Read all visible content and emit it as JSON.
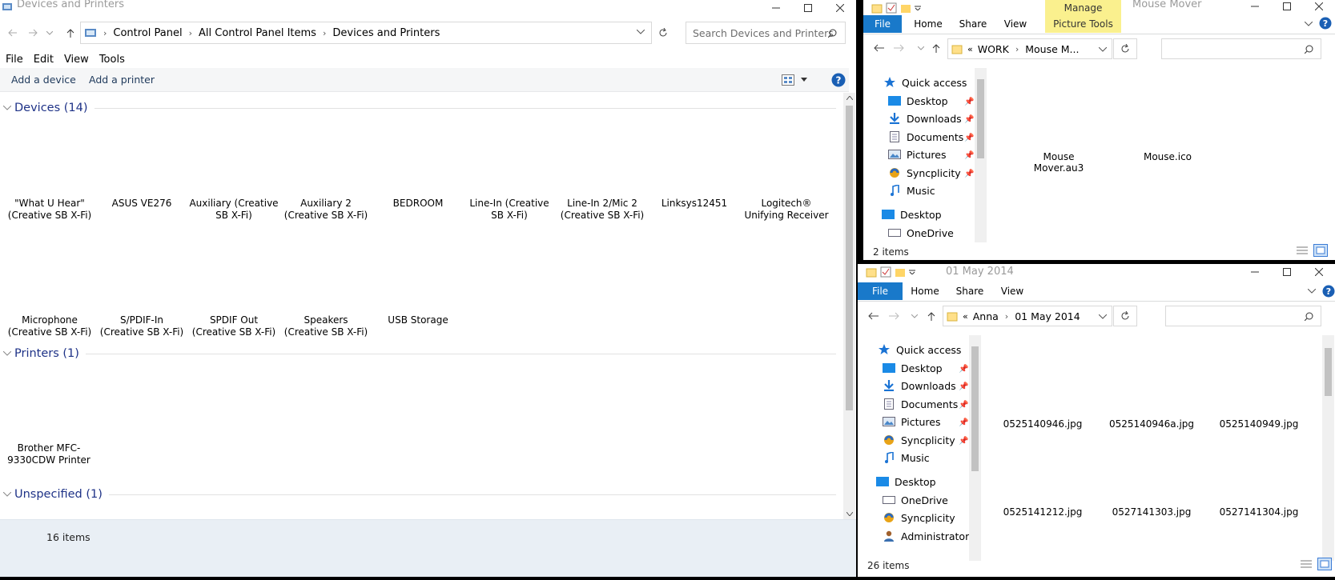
{
  "dp": {
    "title": "Devices and Printers",
    "breadcrumb": [
      "Control Panel",
      "All Control Panel Items",
      "Devices and Printers"
    ],
    "search_placeholder": "Search Devices and Printers",
    "menu": [
      "File",
      "Edit",
      "View",
      "Tools"
    ],
    "commands": [
      "Add a device",
      "Add a printer"
    ],
    "groups": {
      "devices": "Devices (14)",
      "printers": "Printers (1)",
      "unspecified": "Unspecified (1)"
    },
    "devices_row1": [
      "\"What U Hear\" (Creative SB X-Fi)",
      "ASUS VE276",
      "Auxiliary (Creative SB X-Fi)",
      "Auxiliary 2 (Creative SB X-Fi)",
      "BEDROOM",
      "Line-In (Creative SB X-Fi)",
      "Line-In 2/Mic 2 (Creative SB X-Fi)",
      "Linksys12451",
      "Logitech® Unifying Receiver"
    ],
    "devices_row2": [
      "Microphone (Creative SB X-Fi)",
      "S/PDIF-In (Creative SB X-Fi)",
      "SPDIF Out (Creative SB X-Fi)",
      "Speakers (Creative SB X-Fi)",
      "USB Storage"
    ],
    "printers": [
      "Brother MFC-9330CDW Printer"
    ],
    "status": "16 items"
  },
  "win1": {
    "title": "Mouse Mover",
    "tabs": {
      "file": "File",
      "home": "Home",
      "share": "Share",
      "view": "View",
      "manage": "Manage",
      "tools": "Picture Tools"
    },
    "path": [
      "WORK",
      "Mouse M..."
    ],
    "nav": [
      "Quick access",
      "Desktop",
      "Downloads",
      "Documents",
      "Pictures",
      "Syncplicity",
      "Music",
      "Desktop",
      "OneDrive"
    ],
    "files": [
      "Mouse Mover.au3",
      "Mouse.ico"
    ],
    "status": "2 items"
  },
  "win2": {
    "title": "01 May 2014",
    "tabs": {
      "file": "File",
      "home": "Home",
      "share": "Share",
      "view": "View"
    },
    "path": [
      "Anna",
      "01 May 2014"
    ],
    "nav": [
      "Quick access",
      "Desktop",
      "Downloads",
      "Documents",
      "Pictures",
      "Syncplicity",
      "Music",
      "Desktop",
      "OneDrive",
      "Syncplicity",
      "Administrator"
    ],
    "files": [
      "0525140946.jpg",
      "0525140946a.jpg",
      "0525140949.jpg",
      "0525141212.jpg",
      "0527141303.jpg",
      "0527141304.jpg"
    ],
    "status": "26 items"
  },
  "colors": {
    "accent": "#1979ca",
    "group_heading": "#1e3287",
    "manage_tab": "#faf08e",
    "status_bar": "#e9eff5"
  },
  "icons": [
    "control-panel-icon",
    "back-arrow-icon",
    "forward-arrow-icon",
    "up-arrow-icon",
    "refresh-icon",
    "search-icon",
    "help-icon",
    "folder-icon",
    "pin-icon",
    "star-icon",
    "music-icon",
    "onedrive-icon",
    "user-icon"
  ]
}
